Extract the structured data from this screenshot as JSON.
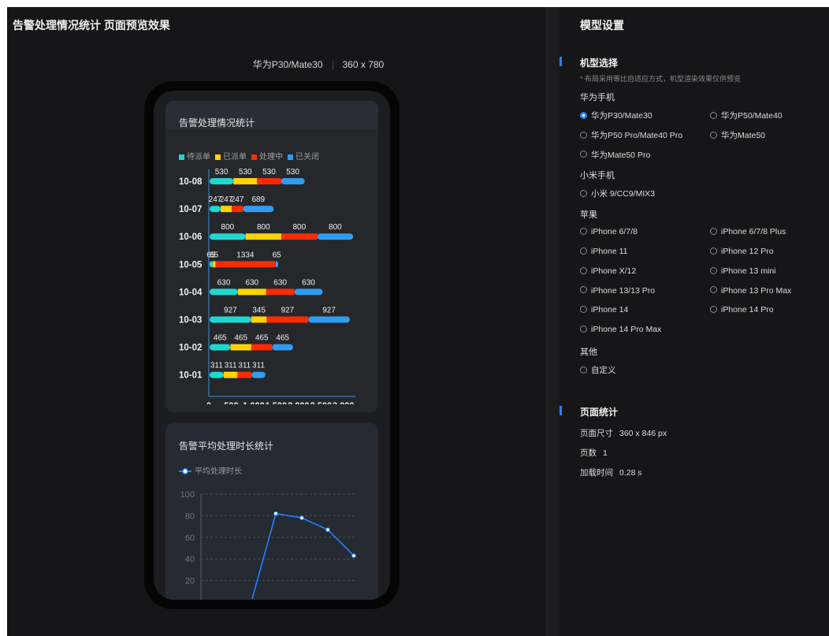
{
  "left": {
    "title": "告警处理情况统计 页面预览效果",
    "device_name": "华为P30/Mate30",
    "resolution": "360 x 780"
  },
  "card1": {
    "title": "告警处理情况统计",
    "legend": [
      {
        "label": "待派单",
        "color": "#1ed8d0"
      },
      {
        "label": "已派单",
        "color": "#ffd400"
      },
      {
        "label": "处理中",
        "color": "#ff2a00"
      },
      {
        "label": "已关闭",
        "color": "#2f9cf0"
      }
    ]
  },
  "card2": {
    "title": "告警平均处理时长统计",
    "legend_label": "平均处理时长"
  },
  "chart_data": [
    {
      "type": "bar",
      "stacked": true,
      "orientation": "horizontal",
      "title": "告警处理情况统计",
      "categories": [
        "10-08",
        "10-07",
        "10-06",
        "10-05",
        "10-04",
        "10-03",
        "10-02",
        "10-01"
      ],
      "series": [
        {
          "name": "待派单",
          "color": "#1ed8d0",
          "values": [
            530,
            247,
            800,
            65,
            630,
            927,
            465,
            311
          ]
        },
        {
          "name": "已派单",
          "color": "#ffd400",
          "values": [
            530,
            247,
            800,
            65,
            630,
            345,
            465,
            311
          ]
        },
        {
          "name": "处理中",
          "color": "#ff2a00",
          "values": [
            530,
            247,
            800,
            1334,
            630,
            927,
            465,
            311
          ]
        },
        {
          "name": "已关闭",
          "color": "#2f9cf0",
          "values": [
            530,
            689,
            800,
            65,
            630,
            927,
            465,
            311
          ]
        }
      ],
      "xticks": [
        "0",
        "500",
        "1,000",
        "1,500",
        "2,000",
        "2,500",
        "3,000"
      ],
      "xlim": [
        0,
        3250
      ],
      "legend_position": "top-left"
    },
    {
      "type": "line",
      "title": "告警平均处理时长统计",
      "series": [
        {
          "name": "平均处理时长",
          "color": "#1f82ff",
          "values": [
            3,
            82,
            78,
            67,
            43
          ]
        }
      ],
      "yticks": [
        "100",
        "80",
        "60",
        "40",
        "20"
      ],
      "ylim": [
        0,
        100
      ],
      "grid": true
    }
  ],
  "right": {
    "title": "模型设置",
    "model_section": "机型选择",
    "hint": "* 布局采用等比自适应方式，机型渲染效果仅供预览",
    "groups": [
      {
        "label": "华为手机",
        "options": [
          "华为P30/Mate30",
          "华为P50/Mate40",
          "华为P50 Pro/Mate40 Pro",
          "华为Mate50",
          "华为Mate50 Pro"
        ]
      },
      {
        "label": "小米手机",
        "options": [
          "小米 9/CC9/MIX3"
        ]
      },
      {
        "label": "苹果",
        "options": [
          "iPhone 6/7/8",
          "iPhone 6/7/8 Plus",
          "iPhone 11",
          "iPhone 12 Pro",
          "iPhone X/12",
          "iPhone 13 mini",
          "iPhone 13/13 Pro",
          "iPhone 13 Pro Max",
          "iPhone 14",
          "iPhone 14 Pro",
          "iPhone 14 Pro Max"
        ]
      },
      {
        "label": "其他",
        "options": [
          "自定义"
        ]
      }
    ],
    "selected": "华为P30/Mate30",
    "stats_section": "页面统计",
    "stats": [
      {
        "label": "页面尺寸",
        "value": "360 x 846 px"
      },
      {
        "label": "页数",
        "value": "1"
      },
      {
        "label": "加载时间",
        "value": "0.28 s"
      }
    ]
  }
}
